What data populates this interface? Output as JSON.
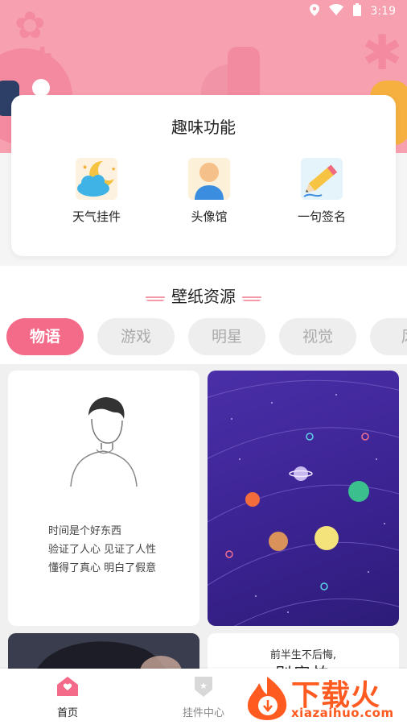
{
  "status_bar": {
    "time": "3:19"
  },
  "fun_section": {
    "title": "趣味功能",
    "items": [
      {
        "label": "天气挂件",
        "icon": "weather-moon-cloud-icon"
      },
      {
        "label": "头像馆",
        "icon": "avatar-person-icon"
      },
      {
        "label": "一句签名",
        "icon": "pencil-signature-icon"
      }
    ]
  },
  "wallpaper_section": {
    "title": "壁纸资源",
    "tabs": [
      "物语",
      "游戏",
      "明星",
      "视觉",
      "风"
    ],
    "active_tab": "物语",
    "cards": [
      {
        "type": "text-illustration",
        "lines": [
          "时间是个好东西",
          "验证了人心 见证了人性",
          "懂得了真心 明白了假意"
        ]
      },
      {
        "type": "planets-illustration"
      },
      {
        "type": "portrait-photo"
      },
      {
        "type": "text",
        "line1": "前半生不后悔,",
        "line2": "别害怕"
      }
    ]
  },
  "bottom_nav": {
    "items": [
      {
        "label": "首页",
        "icon": "home-icon",
        "active": true
      },
      {
        "label": "挂件中心",
        "icon": "widget-shield-icon",
        "active": false
      }
    ]
  },
  "watermark": {
    "text": "下载火",
    "url_text": "xiazaihuo.com"
  },
  "colors": {
    "accent": "#f46a89",
    "header_bg": "#f7a0b0",
    "watermark": "#ff5a1f"
  }
}
